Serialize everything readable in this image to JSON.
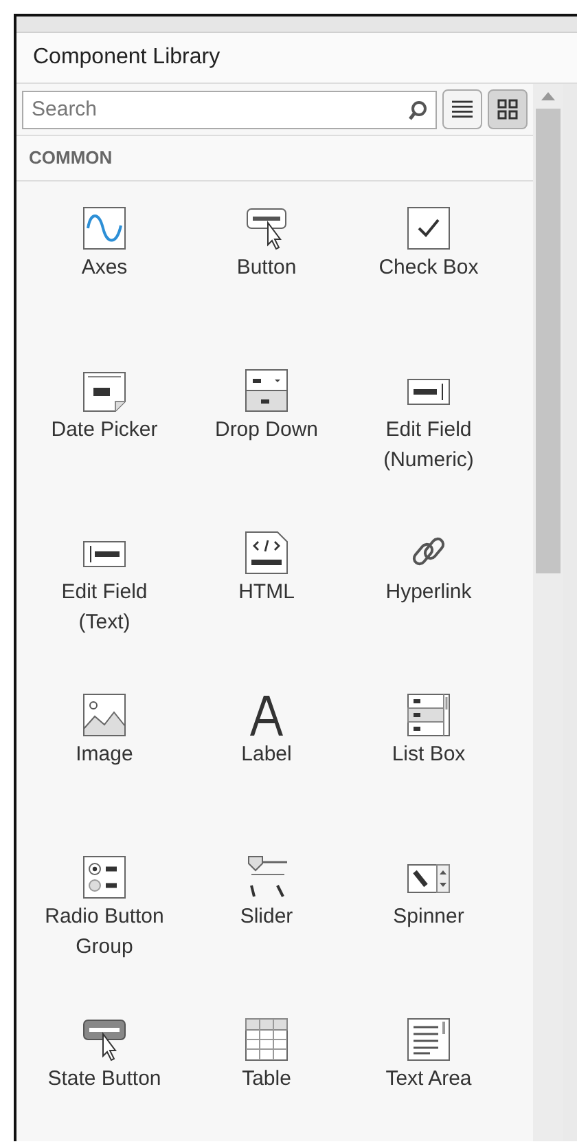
{
  "panel": {
    "title": "Component Library"
  },
  "search": {
    "placeholder": "Search"
  },
  "view_buttons": [
    {
      "kind": "list",
      "selected": false
    },
    {
      "kind": "grid",
      "selected": true
    }
  ],
  "section": {
    "title": "COMMON"
  },
  "components": [
    {
      "kind": "axes",
      "label": [
        "Axes"
      ]
    },
    {
      "kind": "button",
      "label": [
        "Button"
      ]
    },
    {
      "kind": "checkbox",
      "label": [
        "Check Box"
      ]
    },
    {
      "kind": "datepicker",
      "label": [
        "Date Picker"
      ]
    },
    {
      "kind": "dropdown",
      "label": [
        "Drop Down"
      ]
    },
    {
      "kind": "numeric",
      "label": [
        "Edit Field",
        "(Numeric)"
      ]
    },
    {
      "kind": "textfield",
      "label": [
        "Edit Field",
        "(Text)"
      ]
    },
    {
      "kind": "html",
      "label": [
        "HTML"
      ]
    },
    {
      "kind": "hyperlink",
      "label": [
        "Hyperlink"
      ]
    },
    {
      "kind": "image",
      "label": [
        "Image"
      ]
    },
    {
      "kind": "label",
      "label": [
        "Label"
      ]
    },
    {
      "kind": "listbox",
      "label": [
        "List Box"
      ]
    },
    {
      "kind": "radio",
      "label": [
        "Radio Button",
        "Group"
      ]
    },
    {
      "kind": "slider",
      "label": [
        "Slider"
      ]
    },
    {
      "kind": "spinner",
      "label": [
        "Spinner"
      ]
    },
    {
      "kind": "statebutton",
      "label": [
        "State Button"
      ]
    },
    {
      "kind": "table",
      "label": [
        "Table"
      ]
    },
    {
      "kind": "textarea",
      "label": [
        "Text Area"
      ]
    }
  ]
}
